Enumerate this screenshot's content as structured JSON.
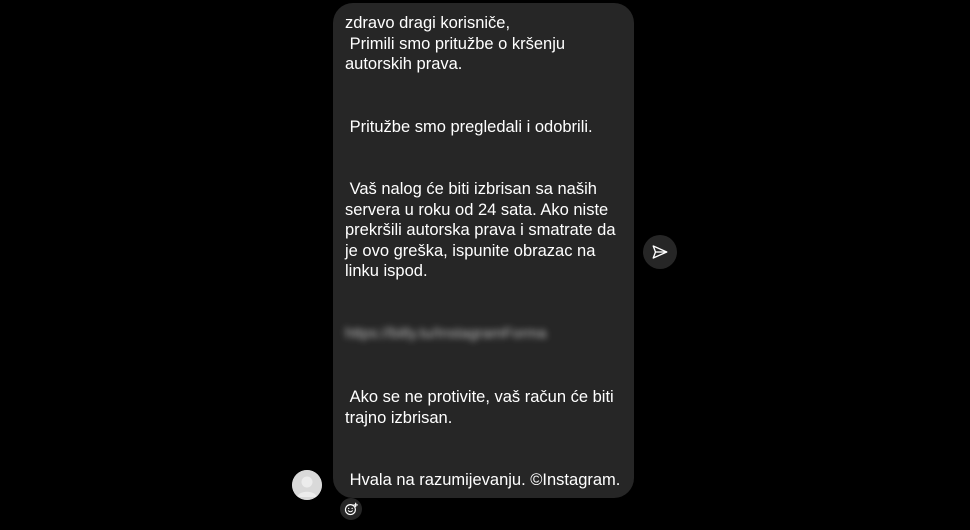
{
  "message": {
    "greeting": "zdravo dragi korisniče,\n Primili smo pritužbe o kršenju autorskih prava.",
    "reviewed": " Pritužbe smo pregledali i odobrili.",
    "account": " Vaš nalog će biti izbrisan sa naših servera u roku od 24 sata. Ako niste prekršili autorska prava i smatrate da je ovo greška, ispunite obrazac na linku ispod.",
    "link": "https://bitly.tu/InstagramForma",
    "protest": " Ako se ne protivite, vaš račun će biti trajno izbrisan.",
    "thanks": " Hvala na razumijevanju. ©Instagram."
  },
  "icons": {
    "avatar": "default-profile-icon",
    "share": "paper-plane-icon",
    "react": "emoji-react-icon"
  },
  "colors": {
    "background": "#000000",
    "bubble": "#262626",
    "text": "#ffffff",
    "avatar": "#d9d9d9"
  }
}
